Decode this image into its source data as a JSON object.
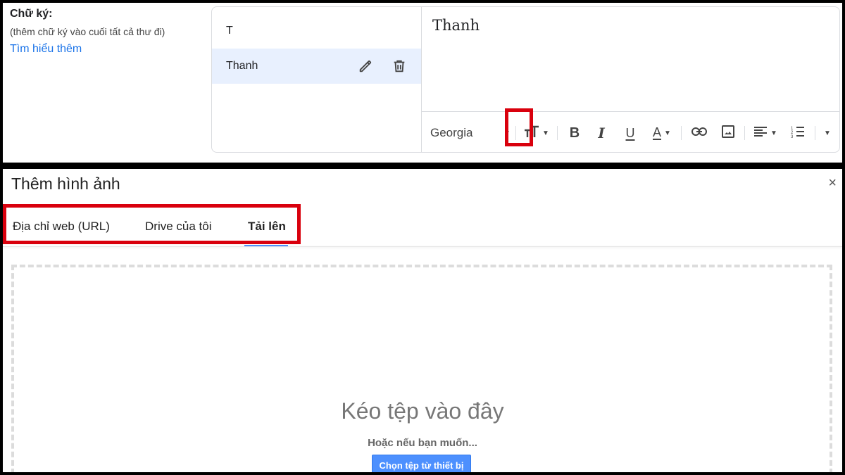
{
  "signature_settings": {
    "label": "Chữ ký:",
    "hint": "(thêm chữ ký vào cuối tất cả thư đi)",
    "learn_more": "Tìm hiểu thêm",
    "signatures": [
      {
        "name": "T"
      },
      {
        "name": "Thanh",
        "selected": true
      }
    ],
    "editor_text": "Thanh",
    "toolbar": {
      "font": "Georgia",
      "buttons": [
        "font-size",
        "bold",
        "italic",
        "underline",
        "text-color",
        "link",
        "insert-image",
        "align",
        "numbered-list",
        "more"
      ],
      "highlighted": "insert-image"
    }
  },
  "dialog": {
    "title": "Thêm hình ảnh",
    "close": "×",
    "tabs": [
      {
        "label": "Địa chỉ web (URL)"
      },
      {
        "label": "Drive của tôi"
      },
      {
        "label": "Tải lên",
        "active": true
      }
    ],
    "drop_title": "Kéo tệp vào đây",
    "drop_subtitle": "Hoặc nếu bạn muốn...",
    "choose_button": "Chọn tệp từ thiết bị"
  },
  "colors": {
    "highlight": "#d9000d",
    "link": "#1a73e8",
    "selected_row": "#e8f0fe",
    "primary_button": "#4d90fe"
  }
}
